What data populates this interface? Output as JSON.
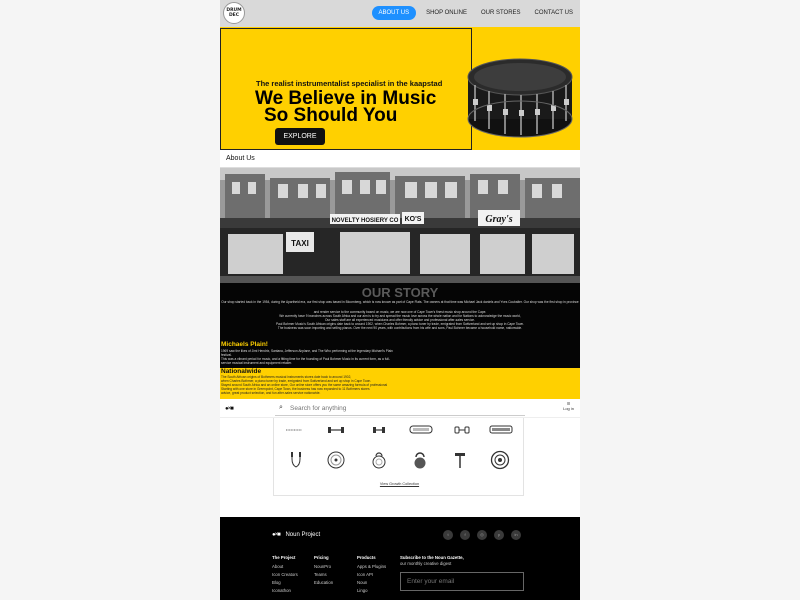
{
  "nav": {
    "logo_text": "DRUM DEC",
    "links": [
      "ABOUT US",
      "SHOP ONLINE",
      "OUR STORES",
      "CONTACT US"
    ],
    "active_color": "#1e90ff"
  },
  "hero": {
    "tagline": "The realist instrumentalist specialist in the kaapstad",
    "headline_1": "We Believe in Music",
    "headline_2": "So Should You",
    "cta": "EXPLORE",
    "bg_color": "#ffd000"
  },
  "about": {
    "title": "About Us",
    "store_signs": [
      "NOVELTY HOSIERY CO",
      "KO'S",
      "Gray's",
      "TAXI"
    ]
  },
  "story": {
    "title": "OUR STORY",
    "paragraphs": [
      "Our shop started back in the 1954, during the Apartheid era, our first shop was based in Bloomberg, which is now known as part of Cape Flats. The owners at that time was Michael Jack daniels and Yves Coubalter. Our shop was the first shop in province",
      "and render service to the community based on music, we are now one of Cape Town's finest music shop around the Cape.",
      "We currently have 9 branches across South Africa and our aim is to try and spread the music love across the whole nation and for Nations to acknowledge the music world,",
      "Our sales staff are all experienced musicians and offer friendly advice and professional after-sales service.",
      "Paul Bohmer Music's South African origins date back to around 1902, when Charles Bohmer, a piano tuner by trade, emigrated from Switzerland and set up shop in Cape Town.",
      "The business was soon importing and selling pianos. Over the next 90 years, with contributions from his wife and sons, Paul Bohmer became a household name, nationwide."
    ],
    "michaels_title": "Michaels Plain!",
    "michaels_text": [
      "1969 saw the likes of Jimi Hendrix, Santana, Jefferson Airplane, and The Who performing at the legendary Michael's Plain",
      "festival.",
      "This was a vibrant period for music, and a fitting time for the founding of Paul Bohmer Music in its current form, as a full-",
      "service musical instrument and equipment retailer."
    ]
  },
  "nationwide": {
    "title": "Nationalwide",
    "text": [
      "The South African origins of Bothmers musical instruments stores date back to around 1902,",
      "when Charles Bothmer, a piano tuner by trade, emigrated from Switzerland and set up shop in Cape Town.",
      "Stayed around South Africa and an online store, Our online store offers you the same amazing formula of professional",
      "Starting with one store in Greenpoint, Cape Town, the business has now expanded to 11 Bothmers stores",
      "advice, great product selection, and fun after-sales service nationwide."
    ]
  },
  "noun": {
    "logo": "●×■",
    "search_placeholder": "Search for anything",
    "login": "Log in",
    "view_collection": "View Growth Collection",
    "icons": [
      "barbell-icon",
      "dumbbell-icon",
      "dumbbell-small-icon",
      "step-bench-icon",
      "grip-dumbbell-icon",
      "treadmill-icon",
      "jump-rope-icon",
      "weight-plate-icon",
      "kettlebell-icon",
      "kettlebell-handle-icon",
      "hammer-weight-icon",
      "disc-weight-icon"
    ]
  },
  "footer": {
    "logo_text": "Noun Project",
    "social_icons": [
      "twitter-icon",
      "facebook-icon",
      "instagram-icon",
      "pinterest-icon",
      "linkedin-icon"
    ],
    "columns": [
      {
        "title": "The Project",
        "items": [
          "About",
          "Icon Creators",
          "Blog",
          "Iconathon"
        ]
      },
      {
        "title": "Pricing",
        "items": [
          "NounPro",
          "Teams",
          "Education"
        ]
      },
      {
        "title": "Products",
        "items": [
          "Apps & Plugins",
          "Icon API",
          "Noun",
          "Lingo"
        ]
      }
    ],
    "subscribe_title": "Subscribe to the Noun Gazette,",
    "subscribe_sub": "our monthly creative digest",
    "email_placeholder": "Enter your email"
  }
}
